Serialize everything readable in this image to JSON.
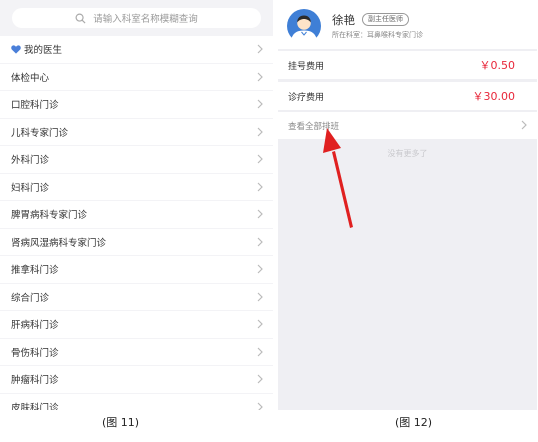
{
  "left": {
    "search": {
      "placeholder": "请输入科室名称模糊查询"
    },
    "items": [
      {
        "label": "我的医生",
        "icon": "heart-icon"
      },
      {
        "label": "体检中心"
      },
      {
        "label": "口腔科门诊"
      },
      {
        "label": "儿科专家门诊"
      },
      {
        "label": "外科门诊"
      },
      {
        "label": "妇科门诊"
      },
      {
        "label": "脾胃病科专家门诊"
      },
      {
        "label": "肾病风湿病科专家门诊"
      },
      {
        "label": "推拿科门诊"
      },
      {
        "label": "综合门诊"
      },
      {
        "label": "肝病科门诊"
      },
      {
        "label": "骨伤科门诊"
      },
      {
        "label": "肿瘤科门诊"
      },
      {
        "label": "皮肤科门诊"
      }
    ]
  },
  "right": {
    "doctor": {
      "name": "徐艳",
      "title": "副主任医师",
      "dept": "所在科室：耳鼻喉科专家门诊"
    },
    "fees": [
      {
        "label": "挂号费用",
        "amount": "￥0.50"
      },
      {
        "label": "诊疗费用",
        "amount": "￥30.00"
      }
    ],
    "view_schedule": "查看全部排班",
    "no_more": "没有更多了"
  },
  "captions": {
    "left": "(图 11)",
    "right": "(图 12)"
  },
  "colors": {
    "accent_red": "#e8273a",
    "heart_blue": "#4a7fd9",
    "arrow_red": "#e02020"
  }
}
